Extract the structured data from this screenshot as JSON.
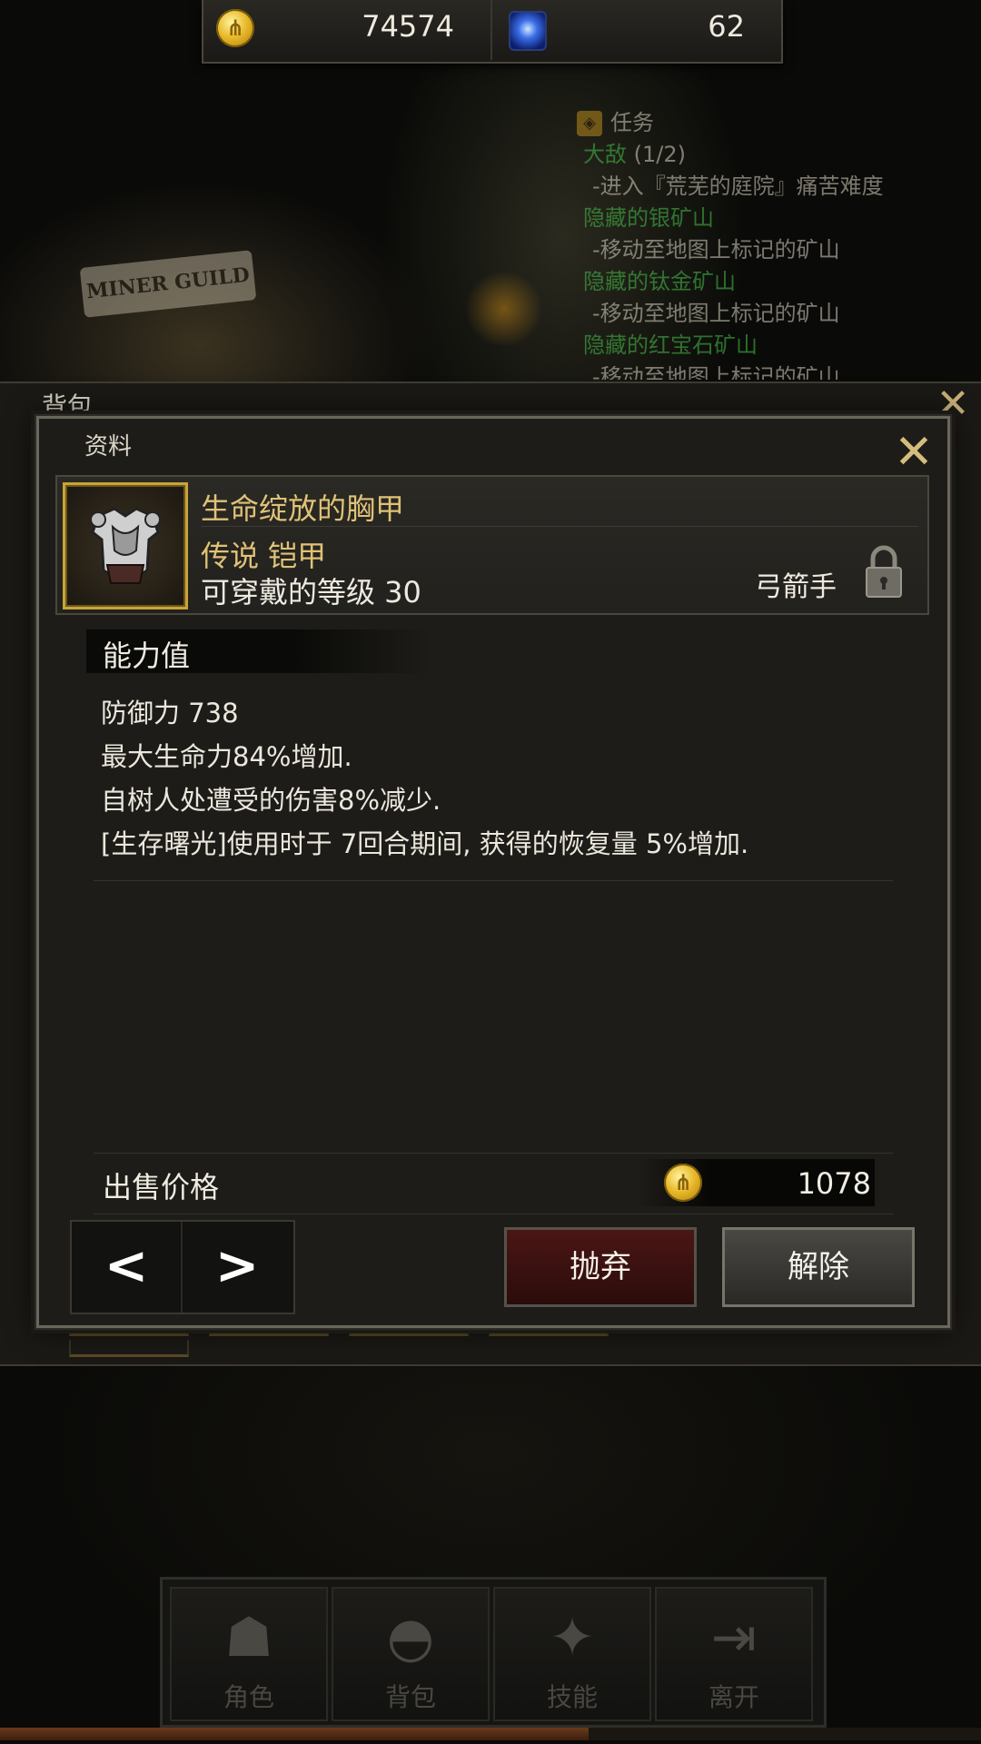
{
  "currency": {
    "gold": "74574",
    "gems": "62"
  },
  "quest": {
    "header": "任务",
    "entries": [
      {
        "title": "大敌",
        "count": "(1/2)",
        "desc": "-进入『荒芜的庭院』痛苦难度"
      },
      {
        "title": "隐藏的银矿山",
        "desc": "-移动至地图上标记的矿山"
      },
      {
        "title": "隐藏的钛金矿山",
        "desc": "-移动至地图上标记的矿山"
      },
      {
        "title": "隐藏的红宝石矿山",
        "desc": "-移动至地图上标记的矿山"
      }
    ]
  },
  "map": {
    "sign": "MINER GUILD"
  },
  "inventory": {
    "title": "背包"
  },
  "dialog": {
    "title": "资料",
    "item": {
      "name": "生命绽放的胸甲",
      "grade": "传说 铠甲",
      "level": "可穿戴的等级 30",
      "class": "弓箭手",
      "icon": "chest-armor-icon"
    },
    "section_title": "能力值",
    "stats": [
      "防御力 738",
      "最大生命力84%增加.",
      "自树人处遭受的伤害8%减少.",
      "[生存曙光]使用时于 7回合期间, 获得的恢复量 5%增加."
    ],
    "price_label": "出售价格",
    "price_value": "1078",
    "buttons": {
      "discard": "抛弃",
      "release": "解除"
    }
  },
  "bottom_nav": [
    {
      "label": "角色",
      "icon": "hooded-figure-icon"
    },
    {
      "label": "背包",
      "icon": "bag-icon"
    },
    {
      "label": "技能",
      "icon": "swords-icon"
    },
    {
      "label": "离开",
      "icon": "exit-door-icon"
    }
  ],
  "xp_progress": 0.6,
  "colors": {
    "gold_text": "#e0c277",
    "quest_green": "#46c24a",
    "discard_red": "#4a1614"
  }
}
